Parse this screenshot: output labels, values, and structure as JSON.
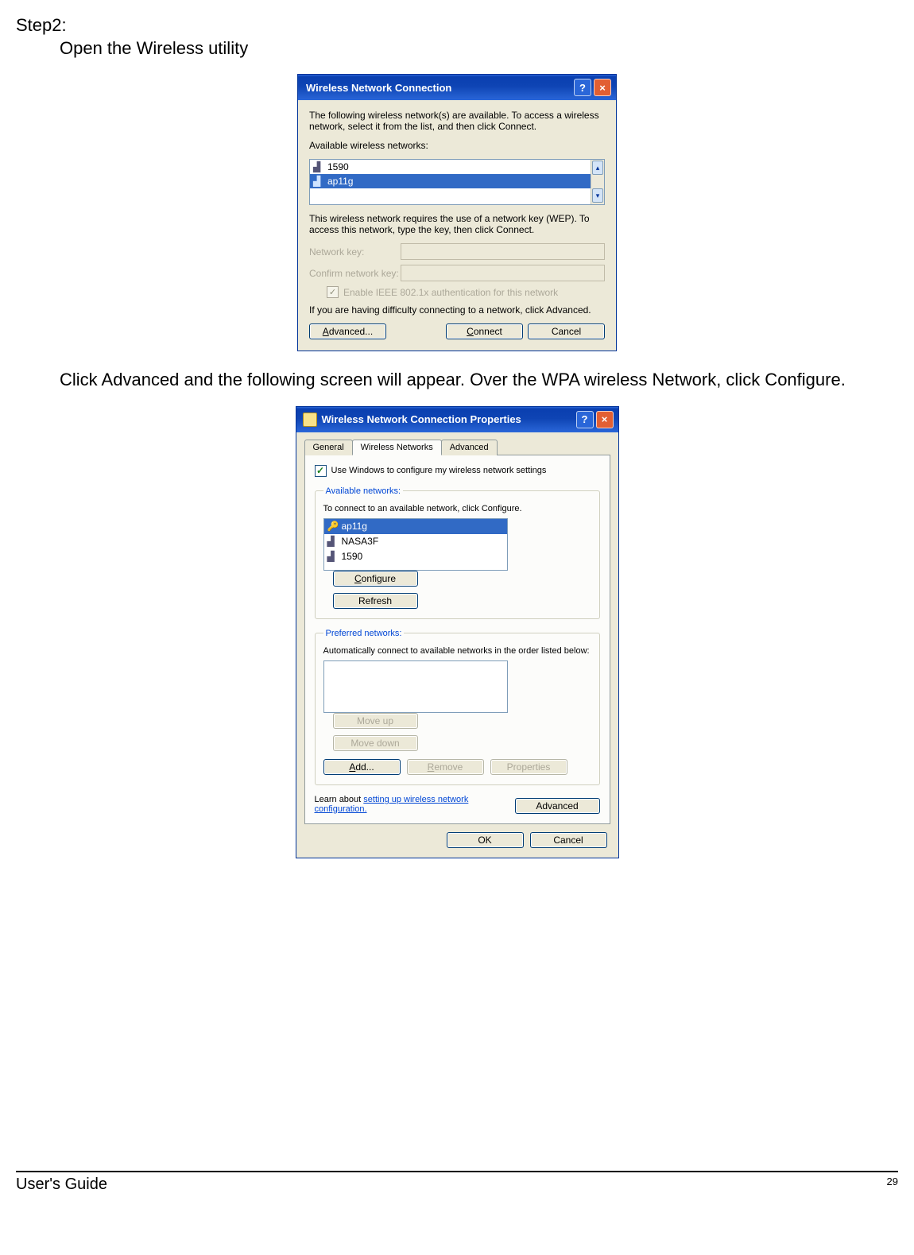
{
  "step": {
    "label": "Step2:",
    "line1": "Open the Wireless utility"
  },
  "mid_text": "Click Advanced and the following screen will appear. Over the WPA wireless Network, click Configure.",
  "footer": {
    "guide": "User's Guide",
    "page": "29"
  },
  "dlg1": {
    "title": "Wireless Network Connection",
    "intro": "The following wireless network(s) are available. To access a wireless network, select it from the list, and then click Connect.",
    "avail_label": "Available wireless networks:",
    "items": [
      "1590",
      "ap11g"
    ],
    "wep_text": "This wireless network requires the use of a network key (WEP). To access this network, type the key, then click Connect.",
    "key_label": "Network key:",
    "confirm_label": "Confirm network key:",
    "enable_label": "Enable IEEE 802.1x authentication for this network",
    "diff_text": "If you are having difficulty connecting to a network, click Advanced.",
    "btn_adv": "Advanced...",
    "btn_connect": "Connect",
    "btn_cancel": "Cancel"
  },
  "dlg2": {
    "title": "Wireless Network Connection Properties",
    "tabs": {
      "general": "General",
      "wireless": "Wireless Networks",
      "advanced": "Advanced"
    },
    "use_windows": "Use Windows to configure my wireless network settings",
    "group_avail": "Available networks:",
    "avail_text": "To connect to an available network, click Configure.",
    "avail_items": [
      "ap11g",
      "NASA3F",
      "1590"
    ],
    "btn_configure": "Configure",
    "btn_refresh": "Refresh",
    "group_pref": "Preferred networks:",
    "pref_text": "Automatically connect to available networks in the order listed below:",
    "btn_moveup": "Move up",
    "btn_movedown": "Move down",
    "btn_add": "Add...",
    "btn_remove": "Remove",
    "btn_properties": "Properties",
    "learn_prefix": "Learn about ",
    "learn_link": "setting up wireless network configuration.",
    "btn_advanced": "Advanced",
    "btn_ok": "OK",
    "btn_cancel": "Cancel"
  }
}
